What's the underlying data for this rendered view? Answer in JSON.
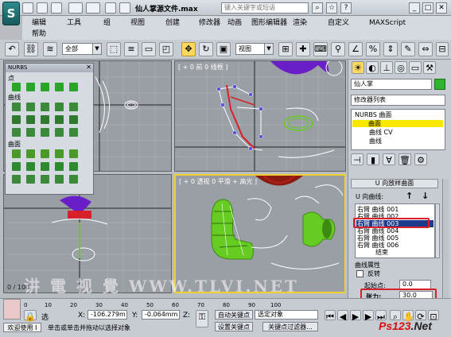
{
  "title_bar": {
    "file_title": "仙人掌源文件.max",
    "search_placeholder": "键入关键字或短语"
  },
  "menu": {
    "items": [
      "编辑",
      "工具",
      "组",
      "视图",
      "创建",
      "修改器",
      "动画",
      "图形编辑器",
      "渲染",
      "自定义",
      "MAXScript",
      "帮助"
    ]
  },
  "toolbar": {
    "selection_filter": "全部",
    "ref_coord": "视图"
  },
  "nurbs_panel": {
    "title": "NURBS",
    "section_point": "点",
    "section_curve": "曲线",
    "section_surface": "曲面"
  },
  "viewports": {
    "top_right_label": "[ + 0 前 0 线框 ]",
    "bottom_right_label": "[ + 0 透视 0 平滑 + 高光 ]",
    "frame_counter": "0 / 100"
  },
  "command_panel": {
    "object_name": "仙人掌",
    "modifier_list": "修改器列表",
    "stack": {
      "root": "NURBS 曲面",
      "sub_items": [
        "曲面",
        "曲线 CV",
        "曲线"
      ]
    },
    "rollout_title": "U 向放样曲面",
    "u_curves_label": "U 向曲线:",
    "curve_list": [
      "右臂 曲线 001",
      "右臂 曲线 002",
      "右臂 曲线 003",
      "右臂 曲线 004",
      "右臂 曲线 005",
      "右臂 曲线 006",
      "结束"
    ],
    "selected_index": 2,
    "curve_props_title": "曲线属性",
    "reverse_label": "反转",
    "start_point_label": "起始点:",
    "start_point_value": "0.0",
    "tension_label": "张力:",
    "tension_value": "30.0"
  },
  "status_bar": {
    "welcome": "欢迎使用 I",
    "selection_state": "选",
    "x_label": "X:",
    "x_value": "-106.279m",
    "y_label": "Y:",
    "y_value": "-0.064mm",
    "z_label": "Z:",
    "auto_key": "自动关键点",
    "selected_object": "选定对象",
    "set_key": "设置关键点",
    "key_filter": "关键点过滤器...",
    "prompt": "单击或单击并拖动以选择对象",
    "time_ticks": [
      "0",
      "10",
      "20",
      "30",
      "40",
      "50",
      "60",
      "70",
      "80",
      "90",
      "100"
    ]
  },
  "watermark": {
    "text": "讲 電 视 覺 WWW.TLVI.NET",
    "ps_logo_main": "Ps123",
    "ps_logo_suffix": ".Net"
  },
  "colors": {
    "highlight_yellow": "#f8d860",
    "annotation_red": "#d8202a",
    "green_object": "#66cc22",
    "purple_object": "#6a1ec8",
    "list_selection": "#1e3a8a"
  }
}
